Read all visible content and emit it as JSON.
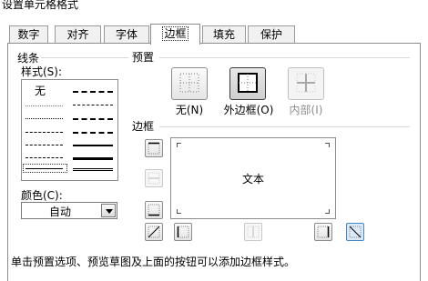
{
  "window": {
    "title": "设置单元格格式"
  },
  "tabs": [
    {
      "label": "数字"
    },
    {
      "label": "对齐"
    },
    {
      "label": "字体"
    },
    {
      "label": "边框"
    },
    {
      "label": "填充"
    },
    {
      "label": "保护"
    }
  ],
  "line_section": {
    "title": "线条",
    "style_label": "样式(S):",
    "none_label": "无",
    "color_label": "颜色(C):",
    "color_value": "自动"
  },
  "preset_section": {
    "title": "预置",
    "buttons": [
      {
        "label": "无(N)",
        "icon": "border-none-icon",
        "state": "normal"
      },
      {
        "label": "外边框(O)",
        "icon": "border-outline-icon",
        "state": "pressed"
      },
      {
        "label": "内部(I)",
        "icon": "border-inside-icon",
        "state": "disabled"
      }
    ]
  },
  "border_section": {
    "title": "边框",
    "preview_text": "文本",
    "buttons": [
      {
        "icon": "border-top-icon",
        "state": "normal"
      },
      {
        "icon": "border-middle-horizontal-icon",
        "state": "disabled"
      },
      {
        "icon": "border-bottom-icon",
        "state": "normal"
      },
      {
        "icon": "border-diagonal-up-icon",
        "state": "normal"
      },
      {
        "icon": "border-left-icon",
        "state": "normal"
      },
      {
        "icon": "border-middle-vertical-icon",
        "state": "disabled"
      },
      {
        "icon": "border-right-icon",
        "state": "normal"
      },
      {
        "icon": "border-diagonal-down-icon",
        "state": "active"
      }
    ]
  },
  "hint": "单击预置选项、预览草图及上面的按钮可以添加边框样式。",
  "colors": {
    "border": "#8c8c8c",
    "active_blue": "#4a86c5",
    "disabled_text": "#8d8d8d"
  }
}
